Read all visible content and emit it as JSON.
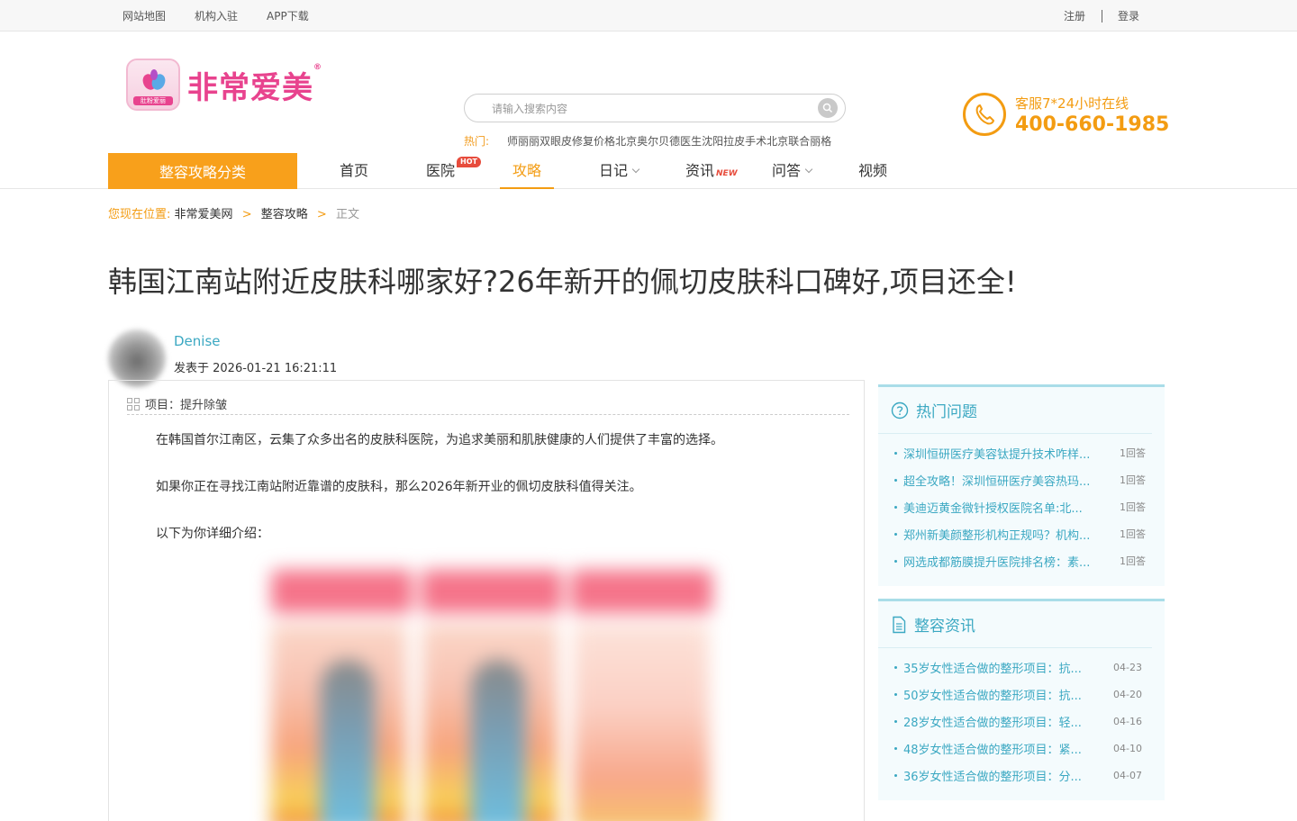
{
  "topbar": {
    "links": [
      "网站地图",
      "机构入驻",
      "APP下载"
    ],
    "register": "注册",
    "login": "登录"
  },
  "header": {
    "logo_text": "非常爱美",
    "logo_tag": "肚粉爱丽",
    "logo_mark": "®",
    "search_placeholder": "请输入搜索内容",
    "hot_label": "热门:",
    "hot_words": [
      "师丽丽双眼皮修复价格",
      "北京奥尔贝德医生",
      "沈阳拉皮手术",
      "北京联合丽格"
    ],
    "service_line": "客服7*24小时在线",
    "service_phone": "400-660-1985"
  },
  "nav": {
    "category_button": "整容攻略分类",
    "items": [
      "首页",
      "医院",
      "攻略",
      "日记",
      "资讯",
      "问答",
      "视频"
    ],
    "hot_badge": "HOT",
    "new_badge": "NEW",
    "active": "攻略"
  },
  "breadcrumb": {
    "label": "您现在位置:",
    "items": [
      "非常爱美网",
      "整容攻略",
      "正文"
    ],
    "separator": ">"
  },
  "article": {
    "title": "韩国江南站附近皮肤科哪家好?26年新开的佩切皮肤科口碑好,项目还全!",
    "author": "Denise",
    "published": "发表于 2026-01-21 16:21:11",
    "project": "项目：提升除皱",
    "paragraphs": [
      "在韩国首尔江南区，云集了众多出名的皮肤科医院，为追求美丽和肌肤健康的人们提供了丰富的选择。",
      "如果你正在寻找江南站附近靠谱的皮肤科，那么2026年新开业的佩切皮肤科值得关注。",
      "以下为你详细介绍："
    ]
  },
  "sidebar": {
    "hot_questions": {
      "title": "热门问题",
      "items": [
        {
          "q": "深圳恒研医疗美容钛提升技术咋样...",
          "n": "1回答"
        },
        {
          "q": "超全攻略！深圳恒研医疗美容热玛...",
          "n": "1回答"
        },
        {
          "q": "美迪迈黄金微针授权医院名单:北...",
          "n": "1回答"
        },
        {
          "q": "郑州新美颜整形机构正规吗？机构...",
          "n": "1回答"
        },
        {
          "q": "网选成都筋膜提升医院排名榜：素...",
          "n": "1回答"
        }
      ]
    },
    "news": {
      "title": "整容资讯",
      "items": [
        {
          "q": "35岁女性适合做的整形项目：抗...",
          "d": "04-23"
        },
        {
          "q": "50岁女性适合做的整形项目：抗...",
          "d": "04-20"
        },
        {
          "q": "28岁女性适合做的整形项目：轻...",
          "d": "04-16"
        },
        {
          "q": "48岁女性适合做的整形项目：紧...",
          "d": "04-10"
        },
        {
          "q": "36岁女性适合做的整形项目：分...",
          "d": "04-07"
        }
      ]
    }
  },
  "colors": {
    "accent_orange": "#f39c12",
    "brand_pink": "#e8438e",
    "link_teal": "#3ba8c2"
  }
}
